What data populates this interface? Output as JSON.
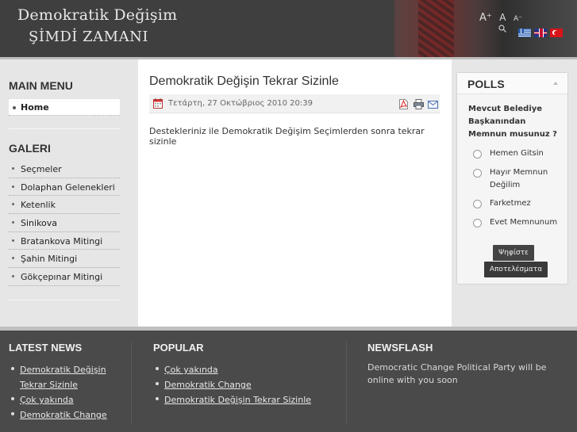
{
  "header": {
    "title_line1": "Demokratik Değişim",
    "title_line2": "ŞİMDİ ZAMANI",
    "font_tools": {
      "large": "A⁺",
      "normal": "A",
      "small": "A⁻"
    },
    "flags": [
      "greek-flag-icon",
      "english-flag-icon",
      "turkish-flag-icon"
    ]
  },
  "left": {
    "main_menu_title": "MAIN MENU",
    "main_menu_items": [
      {
        "label": "Home"
      }
    ],
    "galeri_title": "GALERI",
    "galeri_items": [
      {
        "label": "Seçmeler"
      },
      {
        "label": "Dolaphan Gelenekleri"
      },
      {
        "label": "Ketenlik"
      },
      {
        "label": "Sinikova"
      },
      {
        "label": "Bratankova Mitingi"
      },
      {
        "label": "Şahin Mitingi"
      },
      {
        "label": "Gökçepınar Mitingi"
      }
    ]
  },
  "article": {
    "title": "Demokratik Değişin Tekrar Sizinle",
    "date": "Τετάρτη, 27 Οκτώβριος 2010 20:39",
    "body": "Destekleriniz ile Demokratik Değişim Seçimlerden sonra tekrar sizinle",
    "icons": [
      "pdf-icon",
      "print-icon",
      "email-icon"
    ]
  },
  "polls": {
    "title": "POLLS",
    "question": "Mevcut Belediye Başkanından Memnun musunuz ?",
    "options": [
      {
        "label": "Hemen Gitsin"
      },
      {
        "label": "Hayır Memnun Değilim"
      },
      {
        "label": "Farketmez"
      },
      {
        "label": "Evet Memnunum"
      }
    ],
    "vote_label": "Ψηφίστε",
    "results_label": "Αποτελέσματα"
  },
  "footer": {
    "latest_news_title": "LATEST NEWS",
    "latest_news": [
      {
        "label": "Demokratik Değişin Tekrar Sizinle"
      },
      {
        "label": "Çok yakında"
      },
      {
        "label": "Demokratik Change"
      }
    ],
    "popular_title": "POPULAR",
    "popular": [
      {
        "label": "Çok yakında"
      },
      {
        "label": "Demokratik Change"
      },
      {
        "label": "Demokratik Değişin Tekrar Sizinle"
      }
    ],
    "newsflash_title": "NEWSFLASH",
    "newsflash_text": "Democratic Change Political Party will be online with you soon"
  },
  "colors": {
    "header_bg": "#4a4a4a",
    "side_bg": "#e6e6e6",
    "footer_bg": "#4a4a4a",
    "button_bg": "#444444"
  }
}
